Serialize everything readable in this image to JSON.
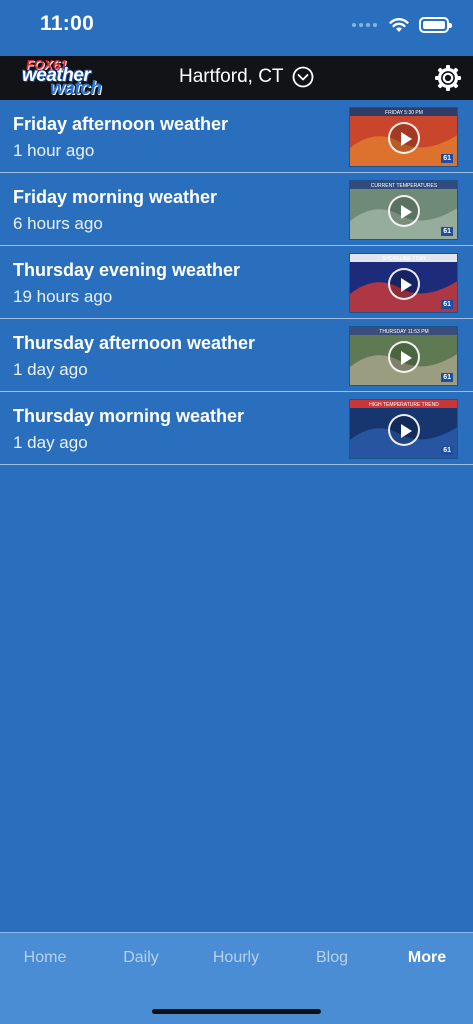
{
  "status": {
    "time": "11:00"
  },
  "header": {
    "logo_fox": "FOX61",
    "logo_weather": "weather",
    "logo_watch": "watch",
    "location": "Hartford, CT"
  },
  "videos": [
    {
      "title": "Friday afternoon weather",
      "time": "1 hour ago",
      "thumb_label": "FRIDAY 5:30 PM",
      "palette": [
        "#c9452b",
        "#e07a2f",
        "#2f3d66"
      ]
    },
    {
      "title": "Friday morning weather",
      "time": "6 hours ago",
      "thumb_label": "CURRENT TEMPERATURES",
      "palette": [
        "#6f8a77",
        "#9fb3a2",
        "#334b7a"
      ]
    },
    {
      "title": "Thursday evening weather",
      "time": "19 hours ago",
      "thumb_label": "SHORELINE 7 DAY",
      "palette": [
        "#1d2c7a",
        "#c73a3a",
        "#e2e6f0"
      ]
    },
    {
      "title": "Thursday afternoon weather",
      "time": "1 day ago",
      "thumb_label": "THURSDAY 11:53 PM",
      "palette": [
        "#5f7a52",
        "#a6a38a",
        "#3b4d7a"
      ]
    },
    {
      "title": "Thursday morning weather",
      "time": "1 day ago",
      "thumb_label": "HIGH TEMPERATURE TREND",
      "palette": [
        "#17356f",
        "#2a5aa8",
        "#c93636"
      ]
    }
  ],
  "tabs": [
    {
      "label": "Home"
    },
    {
      "label": "Daily"
    },
    {
      "label": "Hourly"
    },
    {
      "label": "Blog"
    },
    {
      "label": "More"
    }
  ],
  "colors": {
    "background": "#2a6fbd",
    "header": "#111317",
    "tabbar": "#4a8dd4"
  }
}
